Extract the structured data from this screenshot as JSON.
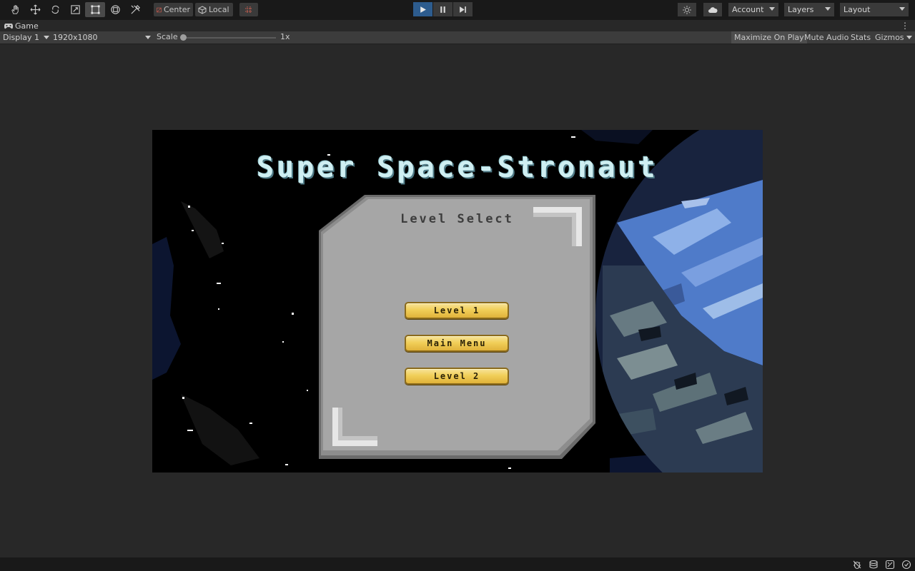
{
  "toolbar": {
    "tools": [
      "hand-icon",
      "move-icon",
      "rotate-icon",
      "scale-icon",
      "rect-icon",
      "transform-icon",
      "custom-tool-icon"
    ],
    "active_tool": "rect-icon",
    "pivot_mode": "Center",
    "pivot_rotation": "Local",
    "grid_snap": "grid-snap-icon",
    "play_controls": [
      "play-icon",
      "pause-icon",
      "step-icon"
    ],
    "account_label": "Account",
    "layers_label": "Layers",
    "layout_label": "Layout"
  },
  "tab": {
    "label": "Game"
  },
  "game_controls": {
    "display": "Display 1",
    "resolution": "1920x1080",
    "scale_label": "Scale",
    "scale_value": "1x",
    "scale_fraction": 0.0,
    "maximize_on_play": "Maximize On Play",
    "mute_audio": "Mute Audio",
    "stats": "Stats",
    "gizmos": "Gizmos"
  },
  "game": {
    "title": "Super Space-Stronaut",
    "panel_title": "Level Select",
    "buttons": [
      "Level 1",
      "Main Menu",
      "Level 2"
    ]
  },
  "colors": {
    "editor_bg": "#282828",
    "toolbar_bg": "#191919",
    "play_active": "#2d5c8e",
    "button_gold": "#f1cf59",
    "panel_gray": "#a6a6a6",
    "title_cyan": "#cfeff2",
    "planet_blue": "#5b83c8"
  },
  "status_icons": [
    "bug-icon",
    "layers-stack-icon",
    "network-icon",
    "check-circle-icon"
  ]
}
